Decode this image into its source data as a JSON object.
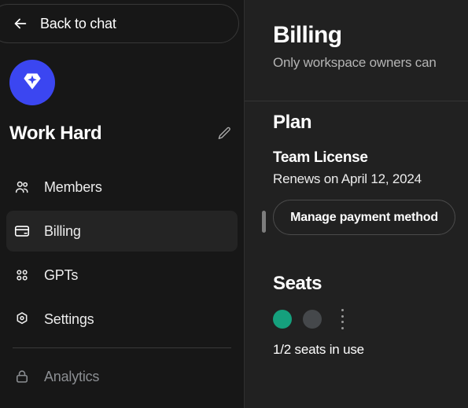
{
  "sidebar": {
    "back_button": {
      "label": "Back to chat",
      "icon": "arrow-left-icon"
    },
    "workspace": {
      "name": "Work Hard",
      "avatar_icon": "diamond-sparkle-icon",
      "avatar_color": "#3b46f1",
      "edit_icon": "pencil-icon"
    },
    "items": [
      {
        "label": "Members",
        "icon": "users-icon",
        "active": false,
        "locked": false
      },
      {
        "label": "Billing",
        "icon": "credit-card-icon",
        "active": true,
        "locked": false
      },
      {
        "label": "GPTs",
        "icon": "grid-icon",
        "active": false,
        "locked": false
      },
      {
        "label": "Settings",
        "icon": "gear-icon",
        "active": false,
        "locked": false
      },
      {
        "label": "Analytics",
        "icon": "lock-icon",
        "active": false,
        "locked": true
      }
    ]
  },
  "main": {
    "title": "Billing",
    "subtitle": "Only workspace owners can",
    "plan": {
      "heading": "Plan",
      "name": "Team License",
      "renewal": "Renews on April 12, 2024",
      "manage_button": "Manage payment method"
    },
    "seats": {
      "heading": "Seats",
      "summary": "1/2 seats in use",
      "used": 1,
      "total": 2,
      "used_color": "#15a07d",
      "free_color": "#45484b",
      "menu_icon": "more-vertical-icon"
    }
  }
}
